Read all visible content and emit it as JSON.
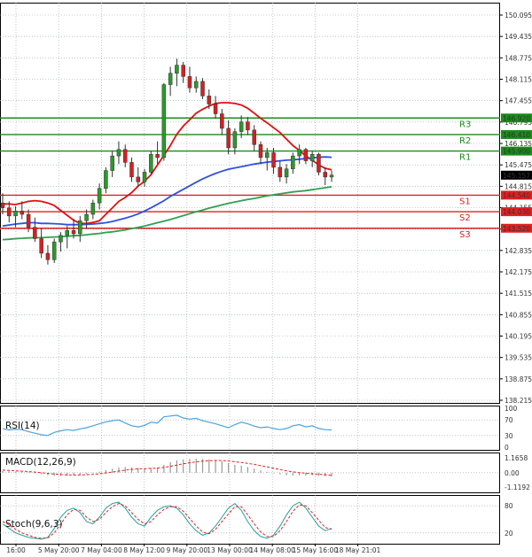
{
  "chart_data": [
    {
      "type": "candlestick",
      "name": "price",
      "ylim": [
        138.215,
        150.095
      ],
      "grid": true,
      "y_ticks": [
        "150.095",
        "149.435",
        "148.775",
        "148.115",
        "147.455",
        "146.795",
        "146.135",
        "145.475",
        "144.815",
        "144.155",
        "143.495",
        "142.835",
        "142.175",
        "141.515",
        "140.855",
        "140.195",
        "139.535",
        "138.875",
        "138.215"
      ],
      "x_ticks": [
        "16:00",
        "5 May 20:00",
        "7 May 04:00",
        "8 May 12:00",
        "9 May 20:00",
        "13 May 00:00",
        "14 May 08:00",
        "15 May 16:00",
        "18 May 21:01"
      ],
      "current_price": "145.157",
      "levels": [
        {
          "label": "R3",
          "value": 146.92,
          "value_label": "146.920",
          "kind": "resistance",
          "color": "#1a8c1a"
        },
        {
          "label": "R2",
          "value": 146.41,
          "value_label": "146.410",
          "kind": "resistance",
          "color": "#1a8c1a"
        },
        {
          "label": "R1",
          "value": 145.9,
          "value_label": "145.900",
          "kind": "resistance",
          "color": "#1a8c1a"
        },
        {
          "label": "S1",
          "value": 144.54,
          "value_label": "144.540",
          "kind": "support",
          "color": "#e02020"
        },
        {
          "label": "S2",
          "value": 144.03,
          "value_label": "144.030",
          "kind": "support",
          "color": "#e02020"
        },
        {
          "label": "S3",
          "value": 143.52,
          "value_label": "143.520",
          "kind": "support",
          "color": "#e02020"
        }
      ],
      "candles": [
        [
          144.3,
          144.6,
          143.95,
          144.15
        ],
        [
          144.15,
          144.35,
          143.7,
          143.9
        ],
        [
          143.9,
          144.2,
          143.55,
          144.05
        ],
        [
          144.05,
          144.35,
          143.8,
          143.95
        ],
        [
          143.95,
          144.1,
          143.4,
          143.55
        ],
        [
          143.55,
          143.85,
          143.1,
          143.2
        ],
        [
          143.2,
          143.5,
          142.6,
          142.75
        ],
        [
          142.75,
          143.0,
          142.4,
          142.55
        ],
        [
          142.55,
          143.2,
          142.45,
          143.1
        ],
        [
          143.1,
          143.4,
          142.8,
          143.3
        ],
        [
          143.3,
          143.6,
          142.9,
          143.45
        ],
        [
          143.45,
          143.8,
          143.2,
          143.35
        ],
        [
          143.35,
          143.9,
          143.1,
          143.75
        ],
        [
          143.75,
          144.1,
          143.5,
          143.95
        ],
        [
          143.95,
          144.4,
          143.8,
          144.3
        ],
        [
          144.3,
          144.9,
          144.1,
          144.75
        ],
        [
          144.75,
          145.4,
          144.6,
          145.3
        ],
        [
          145.3,
          145.9,
          145.1,
          145.75
        ],
        [
          145.75,
          146.2,
          145.5,
          145.95
        ],
        [
          145.95,
          146.1,
          145.4,
          145.55
        ],
        [
          145.55,
          145.7,
          144.95,
          145.1
        ],
        [
          145.1,
          145.4,
          144.8,
          144.95
        ],
        [
          144.95,
          145.35,
          144.8,
          145.25
        ],
        [
          145.25,
          145.9,
          145.2,
          145.8
        ],
        [
          145.8,
          146.2,
          145.5,
          145.7
        ],
        [
          145.7,
          148.0,
          145.6,
          147.95
        ],
        [
          147.95,
          148.5,
          147.6,
          148.3
        ],
        [
          148.3,
          148.75,
          147.9,
          148.55
        ],
        [
          148.55,
          148.65,
          148.0,
          148.2
        ],
        [
          148.2,
          148.5,
          147.7,
          147.85
        ],
        [
          147.85,
          148.2,
          147.7,
          148.05
        ],
        [
          148.05,
          148.15,
          147.5,
          147.6
        ],
        [
          147.6,
          147.8,
          147.2,
          147.35
        ],
        [
          147.35,
          147.6,
          146.9,
          147.05
        ],
        [
          147.05,
          147.2,
          146.4,
          146.6
        ],
        [
          146.6,
          146.85,
          145.8,
          146.0
        ],
        [
          146.0,
          146.6,
          145.8,
          146.5
        ],
        [
          146.5,
          147.0,
          146.3,
          146.8
        ],
        [
          146.8,
          146.95,
          146.4,
          146.55
        ],
        [
          146.55,
          146.7,
          145.9,
          146.1
        ],
        [
          146.1,
          146.2,
          145.5,
          145.7
        ],
        [
          145.7,
          146.0,
          145.3,
          145.85
        ],
        [
          145.85,
          146.0,
          145.2,
          145.4
        ],
        [
          145.4,
          145.6,
          144.95,
          145.1
        ],
        [
          145.1,
          145.5,
          144.9,
          145.35
        ],
        [
          145.35,
          145.85,
          145.2,
          145.75
        ],
        [
          145.75,
          146.1,
          145.5,
          145.95
        ],
        [
          145.95,
          146.0,
          145.5,
          145.6
        ],
        [
          145.6,
          145.9,
          145.4,
          145.8
        ],
        [
          145.8,
          145.85,
          145.15,
          145.25
        ],
        [
          145.25,
          145.4,
          144.85,
          145.1
        ],
        [
          145.1,
          145.3,
          144.95,
          145.16
        ]
      ],
      "series": [
        {
          "name": "",
          "color": "#e01010",
          "values": [
            144.27,
            144.27,
            144.25,
            144.3,
            144.35,
            144.37,
            144.35,
            144.3,
            144.22,
            144.07,
            143.92,
            143.77,
            143.67,
            143.67,
            143.7,
            143.75,
            143.95,
            144.15,
            144.35,
            144.47,
            144.62,
            144.82,
            144.97,
            145.17,
            145.47,
            145.77,
            146.07,
            146.42,
            146.67,
            146.87,
            147.07,
            147.19,
            147.29,
            147.37,
            147.39,
            147.39,
            147.37,
            147.32,
            147.22,
            147.07,
            146.91,
            146.77,
            146.62,
            146.47,
            146.27,
            146.07,
            145.92,
            145.75,
            145.62,
            145.47,
            145.37,
            145.32
          ]
        },
        {
          "name": "",
          "color": "#3050e0",
          "values": [
            143.59,
            143.62,
            143.65,
            143.67,
            143.69,
            143.69,
            143.67,
            143.67,
            143.66,
            143.65,
            143.63,
            143.63,
            143.63,
            143.64,
            143.65,
            143.67,
            143.69,
            143.73,
            143.78,
            143.83,
            143.89,
            143.96,
            144.05,
            144.15,
            144.26,
            144.37,
            144.5,
            144.61,
            144.72,
            144.83,
            144.94,
            145.04,
            145.13,
            145.21,
            145.28,
            145.34,
            145.38,
            145.42,
            145.46,
            145.5,
            145.53,
            145.56,
            145.58,
            145.6,
            145.62,
            145.63,
            145.65,
            145.67,
            145.69,
            145.71,
            145.72,
            145.71
          ]
        },
        {
          "name": "",
          "color": "#30a050",
          "values": [
            143.17,
            143.18,
            143.2,
            143.21,
            143.22,
            143.23,
            143.23,
            143.24,
            143.25,
            143.26,
            143.27,
            143.29,
            143.3,
            143.32,
            143.34,
            143.36,
            143.39,
            143.41,
            143.44,
            143.47,
            143.51,
            143.55,
            143.59,
            143.64,
            143.69,
            143.74,
            143.79,
            143.85,
            143.91,
            143.97,
            144.03,
            144.08,
            144.14,
            144.19,
            144.24,
            144.29,
            144.33,
            144.37,
            144.41,
            144.44,
            144.48,
            144.52,
            144.55,
            144.58,
            144.61,
            144.64,
            144.66,
            144.68,
            144.71,
            144.74,
            144.77,
            144.8
          ]
        }
      ]
    },
    {
      "type": "line",
      "name": "RSI(14)",
      "ylim": [
        0,
        100
      ],
      "y_ticks": [
        "100",
        "70",
        "30",
        "0"
      ],
      "series": [
        {
          "name": "",
          "color": "#4aa3e0",
          "values": [
            48,
            44,
            46,
            45,
            40,
            36,
            32,
            30,
            38,
            42,
            45,
            43,
            47,
            50,
            55,
            60,
            65,
            68,
            70,
            62,
            55,
            52,
            56,
            64,
            62,
            78,
            80,
            82,
            75,
            72,
            74,
            68,
            64,
            60,
            55,
            50,
            58,
            64,
            60,
            54,
            50,
            52,
            48,
            45,
            48,
            55,
            58,
            52,
            55,
            48,
            45,
            44
          ]
        }
      ]
    },
    {
      "type": "bar",
      "name": "MACD(12,26,9)",
      "ylim": [
        -1.1192,
        1.1658
      ],
      "y_ticks": [
        "1.1658",
        "0.00",
        "-1.1192"
      ],
      "values": [
        0.15,
        0.12,
        0.08,
        0.05,
        0.02,
        -0.05,
        -0.12,
        -0.2,
        -0.25,
        -0.26,
        -0.24,
        -0.2,
        -0.15,
        -0.1,
        -0.02,
        0.08,
        0.2,
        0.32,
        0.42,
        0.45,
        0.42,
        0.38,
        0.35,
        0.38,
        0.4,
        0.62,
        0.82,
        0.98,
        1.05,
        1.08,
        1.1,
        1.08,
        1.05,
        1.0,
        0.9,
        0.75,
        0.62,
        0.55,
        0.45,
        0.32,
        0.18,
        0.08,
        -0.02,
        -0.12,
        -0.2,
        -0.22,
        -0.2,
        -0.22,
        -0.2,
        -0.25,
        -0.28,
        -0.3
      ],
      "series": [
        {
          "name": "",
          "color": "#e02020",
          "values": [
            0.2,
            0.18,
            0.15,
            0.12,
            0.09,
            0.05,
            0.0,
            -0.05,
            -0.1,
            -0.14,
            -0.17,
            -0.18,
            -0.18,
            -0.16,
            -0.13,
            -0.08,
            -0.02,
            0.05,
            0.13,
            0.2,
            0.26,
            0.3,
            0.32,
            0.34,
            0.36,
            0.42,
            0.5,
            0.6,
            0.7,
            0.78,
            0.85,
            0.9,
            0.94,
            0.96,
            0.95,
            0.92,
            0.86,
            0.8,
            0.73,
            0.65,
            0.55,
            0.45,
            0.35,
            0.25,
            0.15,
            0.07,
            0.01,
            -0.04,
            -0.08,
            -0.12,
            -0.16,
            -0.2
          ]
        }
      ]
    },
    {
      "type": "line",
      "name": "Stoch(9,6,3)",
      "ylim": [
        0,
        100
      ],
      "y_ticks": [
        "80",
        "20"
      ],
      "series": [
        {
          "name": "",
          "color": "#20a0a0",
          "values": [
            40,
            30,
            20,
            15,
            10,
            8,
            6,
            10,
            30,
            55,
            70,
            75,
            65,
            45,
            40,
            55,
            75,
            85,
            88,
            75,
            55,
            40,
            35,
            55,
            70,
            78,
            80,
            75,
            60,
            40,
            25,
            15,
            20,
            35,
            55,
            75,
            85,
            70,
            45,
            25,
            12,
            8,
            15,
            35,
            60,
            80,
            88,
            75,
            55,
            35,
            25,
            30
          ]
        },
        {
          "name": "",
          "color": "#e02020",
          "values": [
            45,
            38,
            28,
            20,
            15,
            10,
            8,
            9,
            20,
            40,
            60,
            72,
            70,
            55,
            45,
            50,
            65,
            78,
            85,
            80,
            65,
            50,
            40,
            45,
            60,
            72,
            78,
            78,
            68,
            52,
            35,
            22,
            18,
            28,
            45,
            62,
            78,
            78,
            60,
            40,
            22,
            12,
            12,
            25,
            45,
            68,
            82,
            80,
            65,
            48,
            32,
            28
          ]
        }
      ]
    }
  ]
}
